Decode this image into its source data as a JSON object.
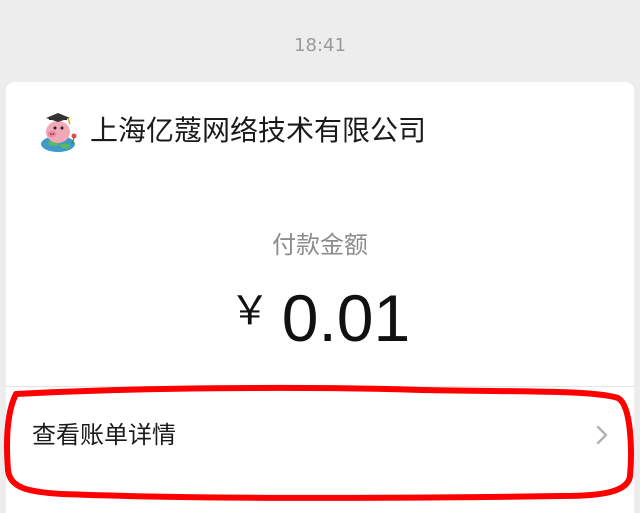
{
  "chat": {
    "timestamp": "18:41"
  },
  "card": {
    "company_name": "上海亿蔻网络技术有限公司",
    "amount_label": "付款金额",
    "currency_symbol": "￥",
    "amount": "0.01",
    "detail_link": "查看账单详情",
    "avatar_icon": "cartoon-pig-graduate-avatar",
    "chevron_icon": "chevron-right-icon"
  },
  "annotation": {
    "highlight_color": "#ff0000"
  }
}
